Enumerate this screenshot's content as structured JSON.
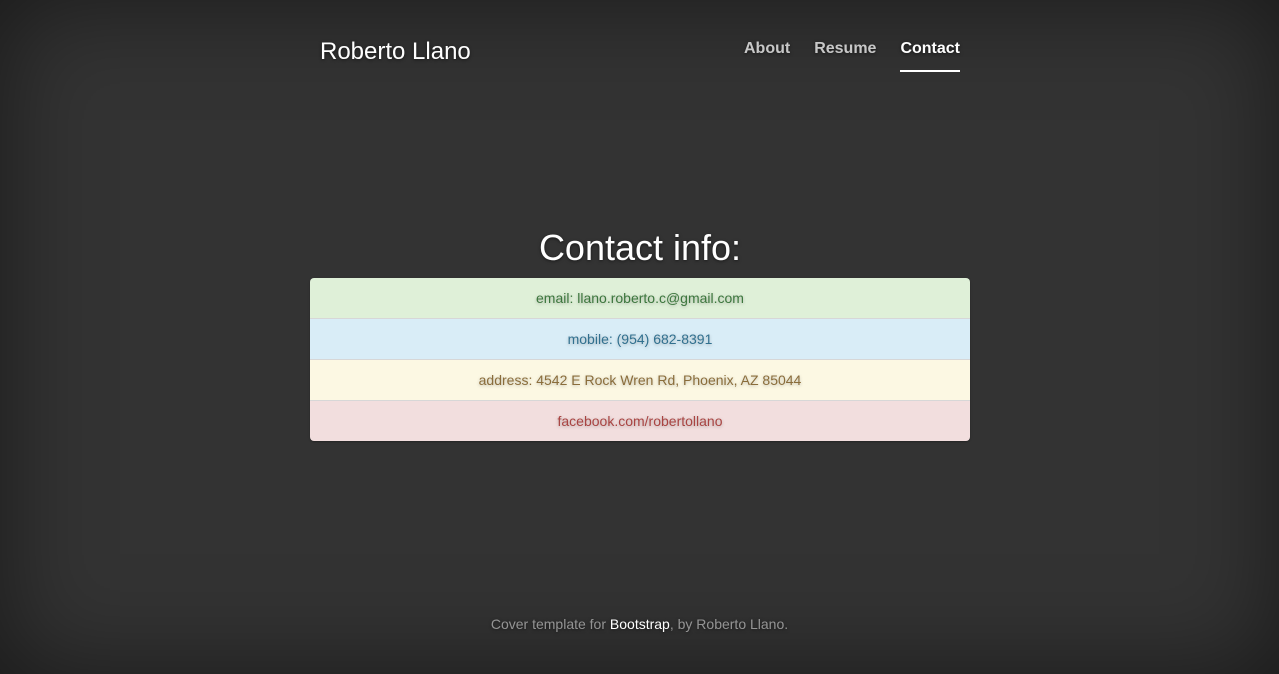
{
  "brand": "Roberto Llano",
  "nav": [
    {
      "label": "About",
      "active": false
    },
    {
      "label": "Resume",
      "active": false
    },
    {
      "label": "Contact",
      "active": true
    }
  ],
  "main": {
    "heading": "Contact info:",
    "items": [
      {
        "text": "email: llano.roberto.c@gmail.com",
        "variant": "success",
        "color": "#3c763d",
        "bg": "#dff0d8"
      },
      {
        "text": "mobile: (954) 682-8391",
        "variant": "info",
        "color": "#31708f",
        "bg": "#d9edf7"
      },
      {
        "text": "address: 4542 E Rock Wren Rd, Phoenix, AZ 85044",
        "variant": "warning",
        "color": "#8a6d3b",
        "bg": "#fcf8e3"
      },
      {
        "text": "facebook.com/robertollano",
        "variant": "danger",
        "color": "#a94442",
        "bg": "#f2dede"
      }
    ]
  },
  "footer": {
    "prefix": "Cover template for ",
    "link": "Bootstrap",
    "suffix": ", by Roberto Llano."
  },
  "colors": {
    "background": "#333333",
    "text": "#ffffff"
  }
}
